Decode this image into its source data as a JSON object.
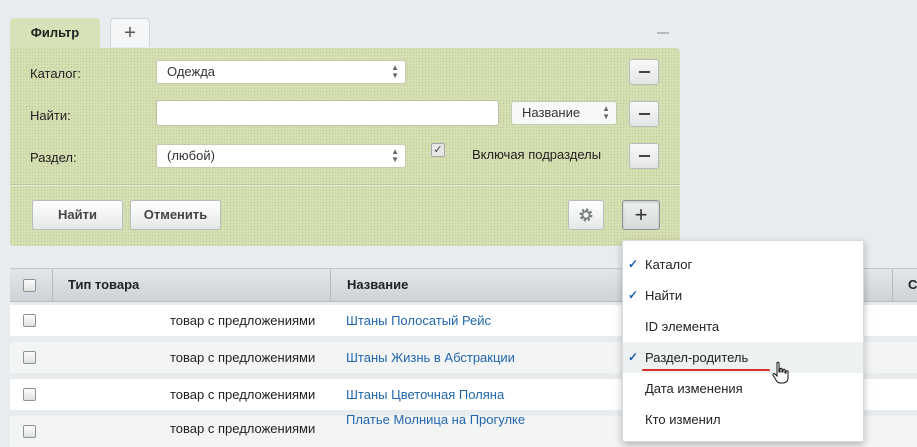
{
  "tabs": {
    "filter_label": "Фильтр",
    "add_symbol": "+"
  },
  "filter": {
    "rows": [
      {
        "label": "Каталог:",
        "value": "Одежда"
      },
      {
        "label": "Найти:",
        "value": "",
        "field_select": "Название"
      },
      {
        "label": "Раздел:",
        "value": "(любой)",
        "checkbox_label": "Включая подразделы",
        "checkbox_checked": true
      }
    ],
    "find_button": "Найти",
    "cancel_button": "Отменить",
    "settings_icon": "gear-icon",
    "add_field_symbol": "+"
  },
  "grid": {
    "columns": [
      "Тип товара",
      "Название",
      "С"
    ],
    "rows": [
      {
        "type": "товар с предложениями",
        "name": "Штаны Полосатый Рейс"
      },
      {
        "type": "товар с предложениями",
        "name": "Штаны Жизнь в Абстракции"
      },
      {
        "type": "товар с предложениями",
        "name": "Штаны Цветочная Поляна"
      },
      {
        "type": "товар с предложениями",
        "name": "Платье Молница на Прогулке"
      }
    ]
  },
  "field_menu": {
    "items": [
      {
        "label": "Каталог",
        "checked": true
      },
      {
        "label": "Найти",
        "checked": true
      },
      {
        "label": "ID элемента",
        "checked": false
      },
      {
        "label": "Раздел-родитель",
        "checked": true,
        "hovered": true
      },
      {
        "label": "Дата изменения",
        "checked": false
      },
      {
        "label": "Кто изменил",
        "checked": false
      }
    ],
    "check_mark": "✓"
  },
  "colors": {
    "filter_panel": "#d5dfb2",
    "link": "#2067b0",
    "check": "#1e5fb3",
    "underline": "#d9312a"
  }
}
